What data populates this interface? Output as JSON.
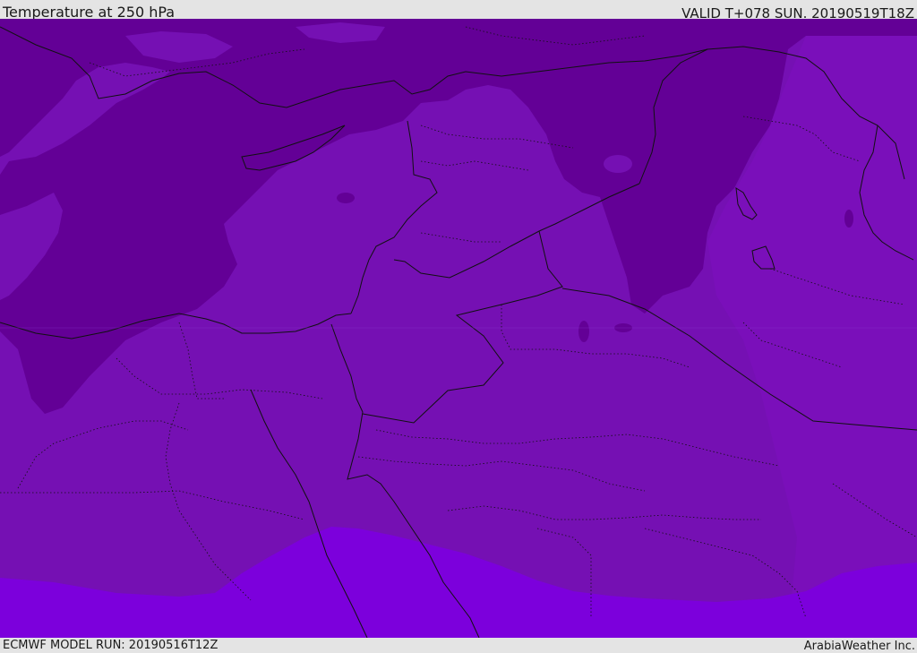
{
  "header": {
    "title": "Temperature at 250 hPa",
    "valid": "VALID T+078 SUN. 20190519T18Z"
  },
  "footer": {
    "model_run": "ECMWF MODEL RUN: 20190516T12Z",
    "credit": "ArabiaWeather Inc."
  },
  "map": {
    "colors": {
      "coldest": "#630096",
      "cold": "#7510b3",
      "mid": "#7a0fba",
      "warm": "#7c00dc",
      "border": "#111111",
      "background": "#e4e4e4"
    }
  }
}
